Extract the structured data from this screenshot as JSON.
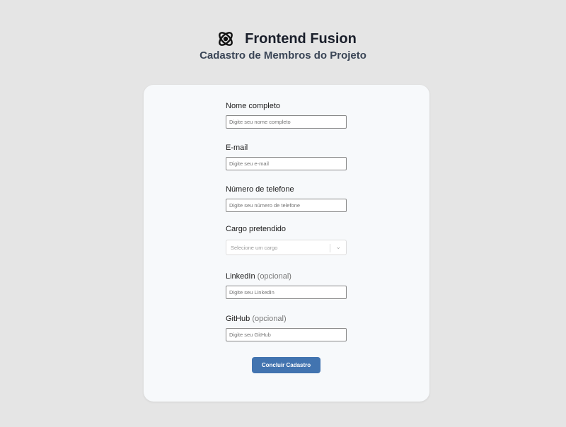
{
  "header": {
    "brand": "Frontend Fusion",
    "subtitle": "Cadastro de Membros do Projeto"
  },
  "form": {
    "name": {
      "label": "Nome completo",
      "placeholder": "Digite seu nome completo"
    },
    "email": {
      "label": "E-mail",
      "placeholder": "Digite seu e-mail"
    },
    "phone": {
      "label": "Número de telefone",
      "placeholder": "Digite seu número de telefone"
    },
    "role": {
      "label": "Cargo pretendido",
      "placeholder": "Selecione um cargo"
    },
    "linkedin": {
      "label": "LinkedIn",
      "optional": "(opcional)",
      "placeholder": "Digite seu LinkedIn"
    },
    "github": {
      "label": "GitHub",
      "optional": "(opcional)",
      "placeholder": "Digite seu GitHub"
    },
    "submit": "Concluir Cadastro"
  }
}
